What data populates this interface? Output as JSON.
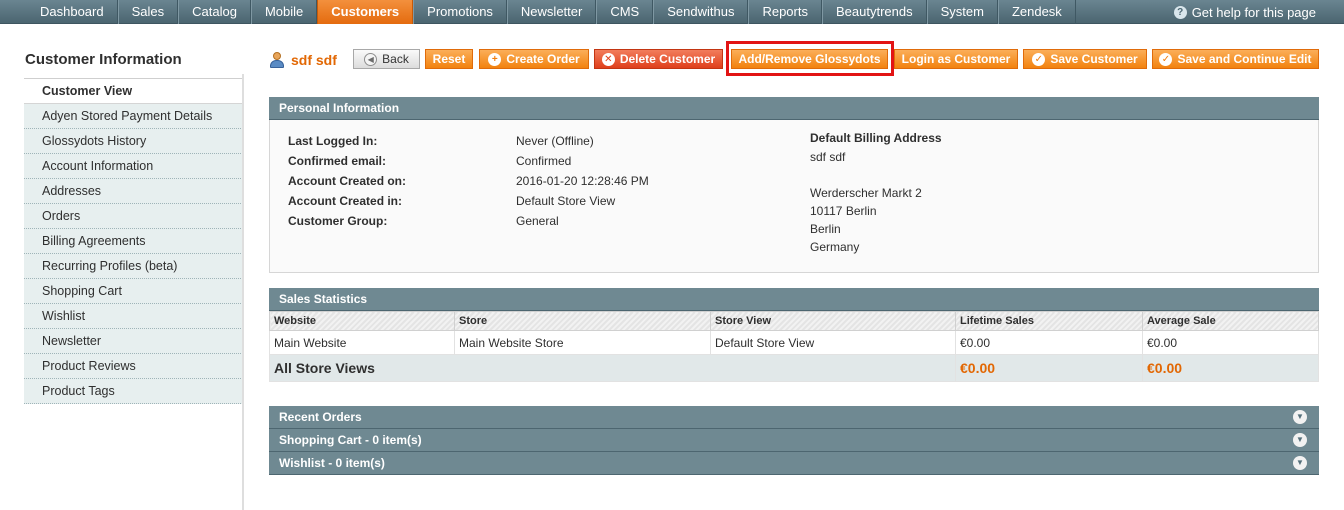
{
  "nav": {
    "items": [
      "Dashboard",
      "Sales",
      "Catalog",
      "Mobile",
      "Customers",
      "Promotions",
      "Newsletter",
      "CMS",
      "Sendwithus",
      "Reports",
      "Beautytrends",
      "System",
      "Zendesk"
    ],
    "active": "Customers",
    "help": "Get help for this page"
  },
  "sidebar": {
    "title": "Customer Information",
    "items": [
      "Customer View",
      "Adyen Stored Payment Details",
      "Glossydots History",
      "Account Information",
      "Addresses",
      "Orders",
      "Billing Agreements",
      "Recurring Profiles (beta)",
      "Shopping Cart",
      "Wishlist",
      "Newsletter",
      "Product Reviews",
      "Product Tags"
    ]
  },
  "header": {
    "customer_name": "sdf sdf",
    "buttons": {
      "back": "Back",
      "reset": "Reset",
      "create_order": "Create Order",
      "delete_customer": "Delete Customer",
      "add_remove_glossydots": "Add/Remove Glossydots",
      "login_as_customer": "Login as Customer",
      "save_customer": "Save Customer",
      "save_continue": "Save and Continue Edit"
    }
  },
  "personal_info": {
    "title": "Personal Information",
    "rows": [
      {
        "label": "Last Logged In:",
        "value": "Never (Offline)"
      },
      {
        "label": "Confirmed email:",
        "value": "Confirmed"
      },
      {
        "label": "Account Created on:",
        "value": "2016-01-20 12:28:46 PM"
      },
      {
        "label": "Account Created in:",
        "value": "Default Store View"
      },
      {
        "label": "Customer Group:",
        "value": "General"
      }
    ],
    "billing_title": "Default Billing Address",
    "billing_lines": [
      "sdf sdf",
      "Werderscher Markt 2",
      "10117 Berlin",
      "Berlin",
      "Germany"
    ]
  },
  "sales_stats": {
    "title": "Sales Statistics",
    "columns": [
      "Website",
      "Store",
      "Store View",
      "Lifetime Sales",
      "Average Sale"
    ],
    "rows": [
      [
        "Main Website",
        "Main Website Store",
        "Default Store View",
        "€0.00",
        "€0.00"
      ]
    ],
    "total_label": "All Store Views",
    "total_lifetime": "€0.00",
    "total_average": "€0.00"
  },
  "collapsibles": [
    "Recent Orders",
    "Shopping Cart - 0 item(s)",
    "Wishlist - 0 item(s)"
  ],
  "colors": {
    "accent": "#e26703",
    "nav_bg": "#5b7580",
    "section_bg": "#6f8992",
    "highlight": "#e21414"
  }
}
